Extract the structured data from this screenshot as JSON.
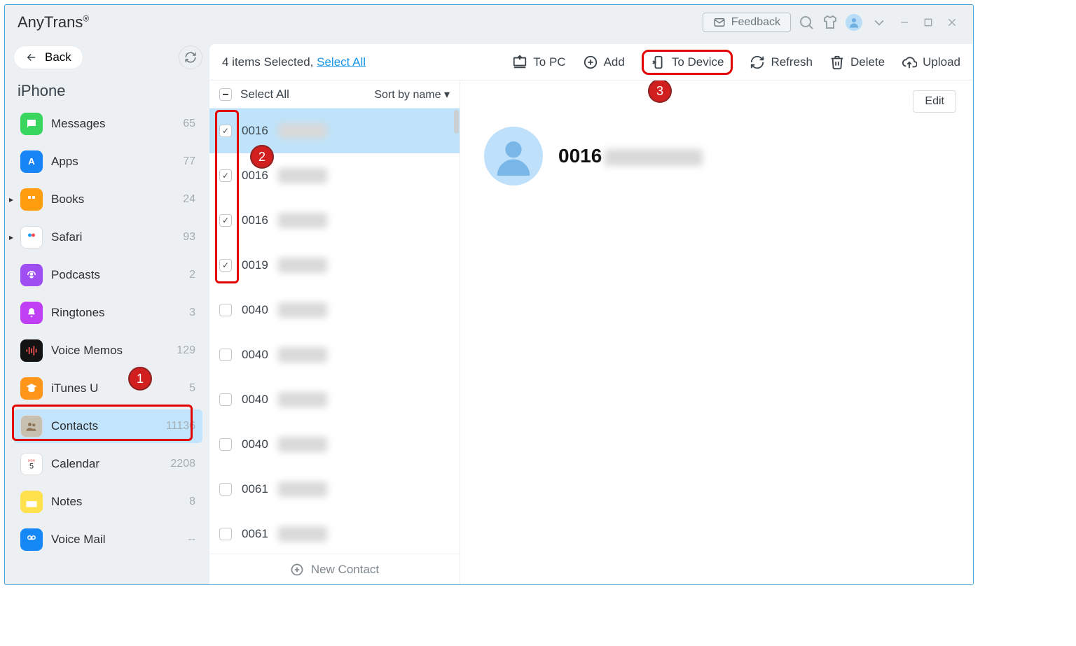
{
  "app_title": "AnyTrans",
  "app_title_mark": "®",
  "feedback_label": "Feedback",
  "back_label": "Back",
  "device_label": "iPhone",
  "sidebar": {
    "items": [
      {
        "label": "Messages",
        "count": "65",
        "color": "#39d65f",
        "expand": false
      },
      {
        "label": "Apps",
        "count": "77",
        "color": "#1785f6",
        "expand": false
      },
      {
        "label": "Books",
        "count": "24",
        "color": "#ff9d0f",
        "expand": true
      },
      {
        "label": "Safari",
        "count": "93",
        "color": "#ffffff",
        "expand": true
      },
      {
        "label": "Podcasts",
        "count": "2",
        "color": "#9f4ef2",
        "expand": false
      },
      {
        "label": "Ringtones",
        "count": "3",
        "color": "#c03ff4",
        "expand": false
      },
      {
        "label": "Voice Memos",
        "count": "129",
        "color": "#131313",
        "expand": false
      },
      {
        "label": "iTunes U",
        "count": "5",
        "color": "#ff9519",
        "expand": false
      },
      {
        "label": "Contacts",
        "count": "11136",
        "color": "#c7bfb0",
        "expand": false,
        "active": true
      },
      {
        "label": "Calendar",
        "count": "2208",
        "color": "#ffffff",
        "expand": false
      },
      {
        "label": "Notes",
        "count": "8",
        "color": "#ffe04d",
        "expand": false
      },
      {
        "label": "Voice Mail",
        "count": "--",
        "color": "#1588f6",
        "expand": false
      }
    ]
  },
  "toolbar": {
    "selection_prefix": "4 items Selected, ",
    "select_all_link": "Select All",
    "actions": {
      "to_pc": "To PC",
      "add": "Add",
      "to_device": "To Device",
      "refresh": "Refresh",
      "delete": "Delete",
      "upload": "Upload"
    }
  },
  "list": {
    "select_all_label": "Select All",
    "sort_label": "Sort by name ▾",
    "new_contact_label": "New Contact",
    "rows": [
      {
        "num": "0016",
        "checked": true,
        "selected": true
      },
      {
        "num": "0016",
        "checked": true
      },
      {
        "num": "0016",
        "checked": true
      },
      {
        "num": "0019",
        "checked": true
      },
      {
        "num": "0040",
        "checked": false
      },
      {
        "num": "0040",
        "checked": false
      },
      {
        "num": "0040",
        "checked": false
      },
      {
        "num": "0040",
        "checked": false
      },
      {
        "num": "0061",
        "checked": false
      },
      {
        "num": "0061",
        "checked": false
      }
    ]
  },
  "detail": {
    "edit_label": "Edit",
    "contact_num": "0016"
  },
  "annotations": {
    "badge1": "1",
    "badge2": "2",
    "badge3": "3"
  }
}
